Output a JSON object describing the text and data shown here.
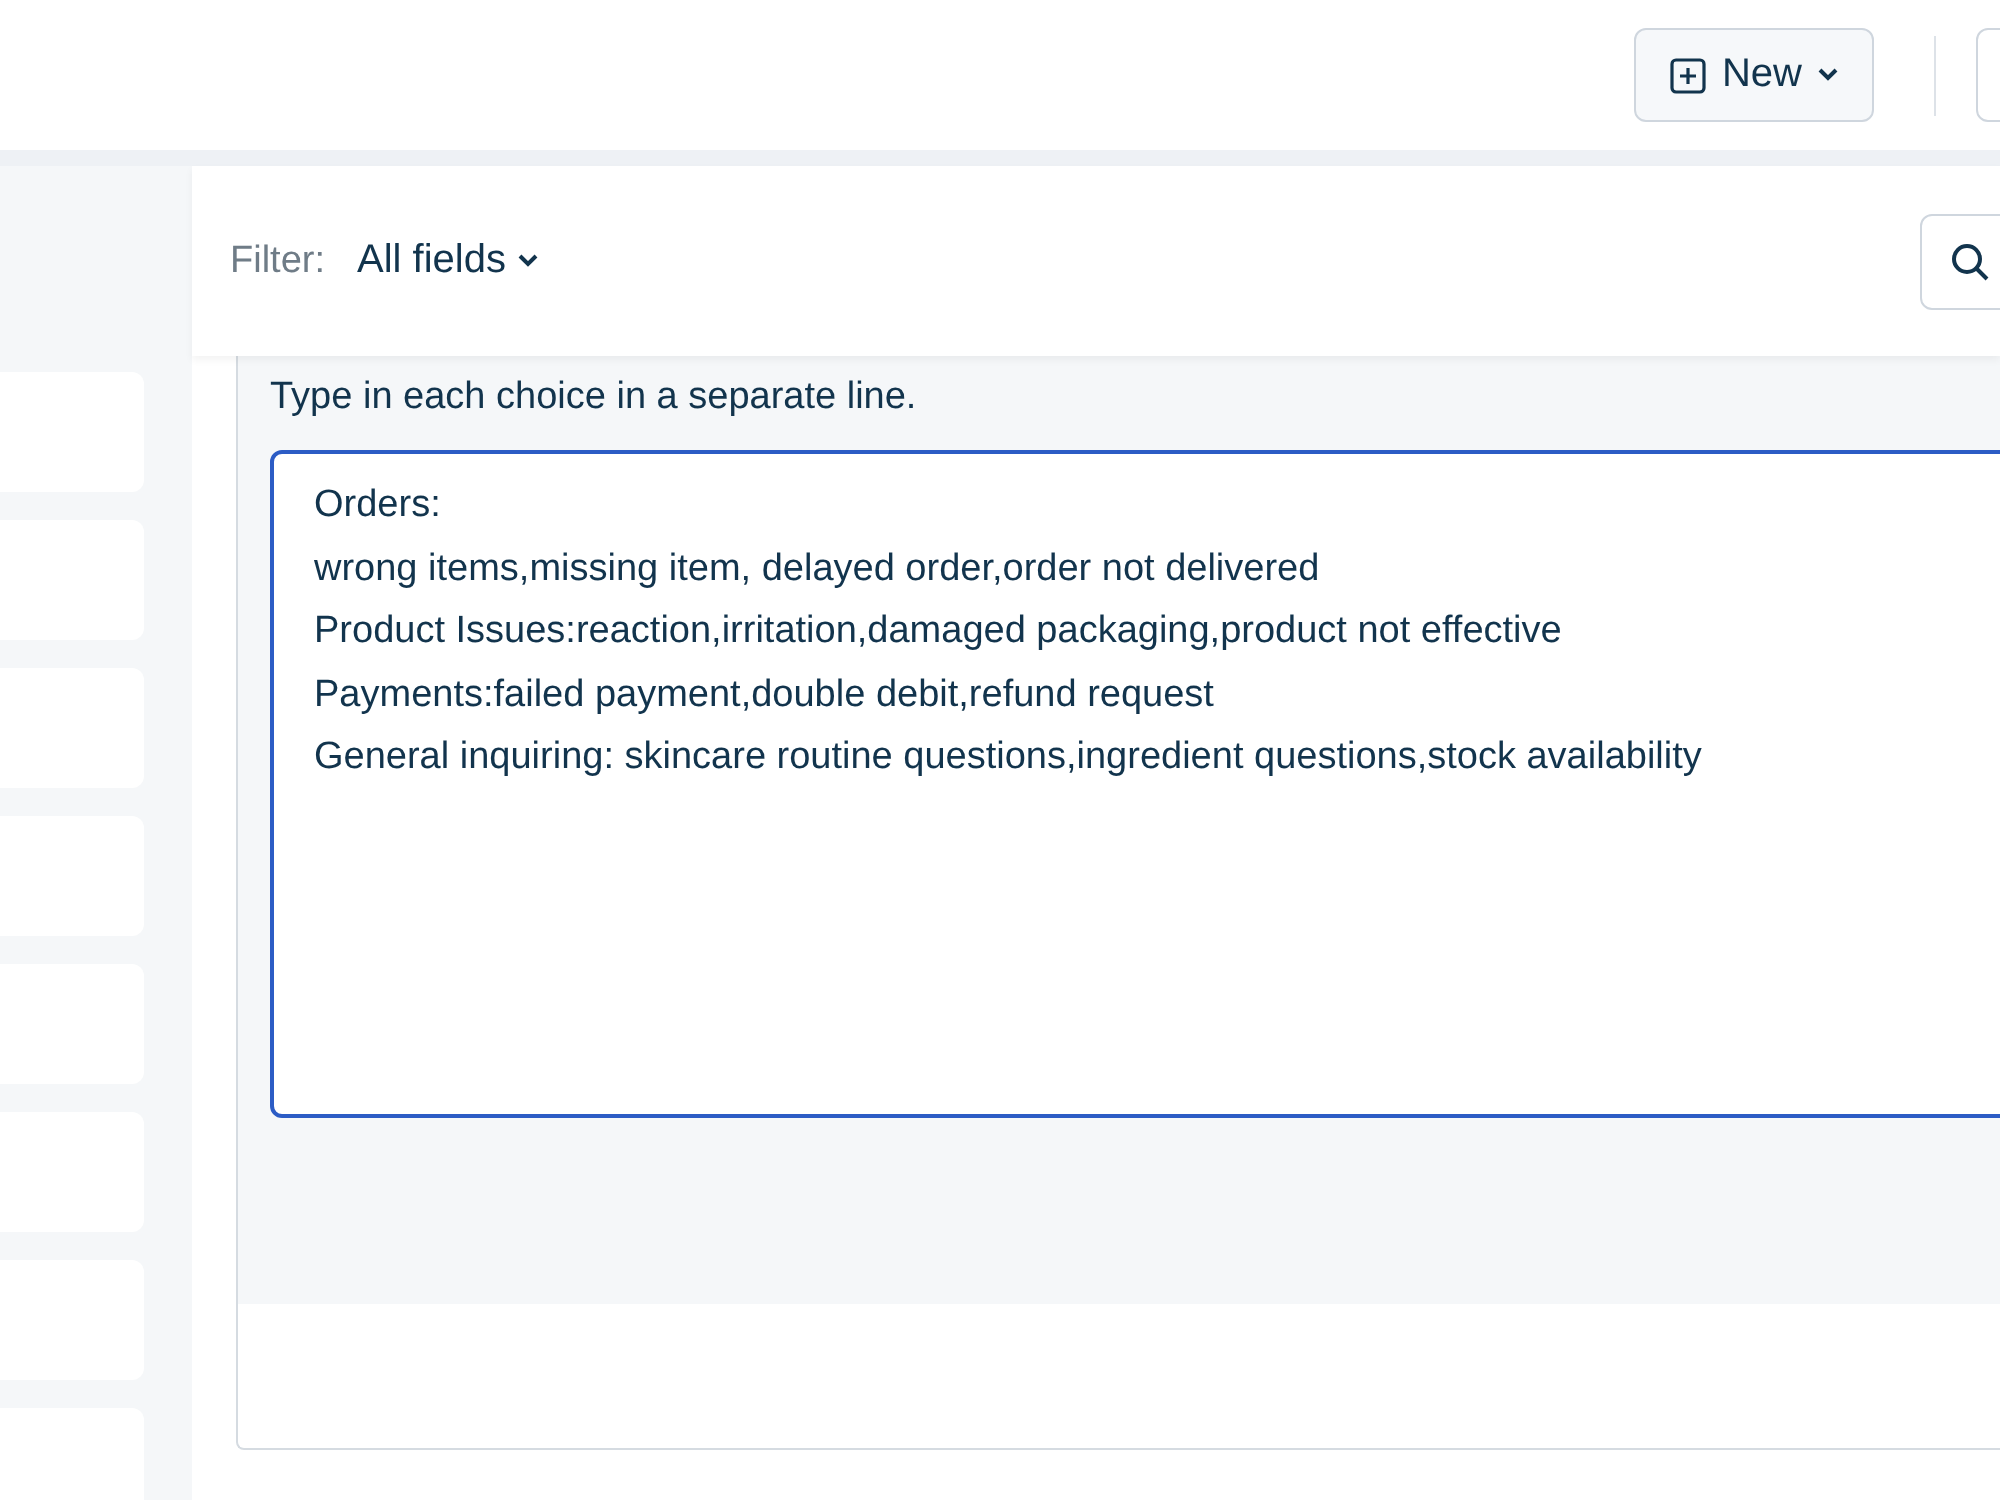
{
  "toolbar": {
    "new_button": {
      "label": "New"
    }
  },
  "filter_bar": {
    "label": "Filter:",
    "value": "All fields"
  },
  "choices_editor": {
    "hint": "Type in each choice in a separate line.",
    "value": "Orders:\nwrong items,missing item, delayed order,order not delivered\nProduct Issues:reaction,irritation,damaged packaging,product not effective\nPayments:failed payment,double debit,refund request\nGeneral inquiring: skincare routine questions,ingredient questions,stock availability",
    "focused": true
  }
}
